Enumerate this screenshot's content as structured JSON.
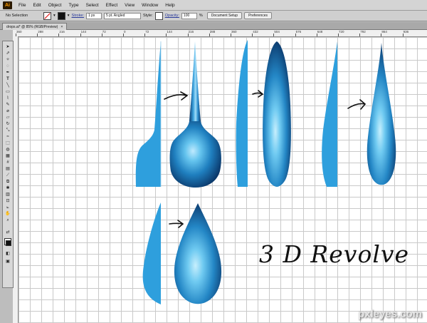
{
  "app": {
    "logo": "Ai"
  },
  "menu": {
    "items": [
      "File",
      "Edit",
      "Object",
      "Type",
      "Select",
      "Effect",
      "View",
      "Window",
      "Help"
    ]
  },
  "control_bar": {
    "selection": "No Selection",
    "stroke_label": "Stroke:",
    "stroke_weight": "1 px",
    "brush": "5 pt. Angled",
    "style_label": "Style:",
    "opacity_label": "Opacity:",
    "opacity_value": "100",
    "opacity_unit": "%",
    "document_setup": "Document Setup",
    "preferences": "Preferences"
  },
  "document": {
    "tab_label": "drops.ai* @ 85% (RGB/Preview)",
    "close_glyph": "×"
  },
  "ruler": {
    "labels": [
      "360",
      "288",
      "216",
      "144",
      "72",
      "0",
      "72",
      "144",
      "216",
      "288",
      "360",
      "432",
      "504",
      "576",
      "648",
      "720",
      "792",
      "864",
      "936"
    ]
  },
  "canvas": {
    "annotation": "3 D Revolve"
  },
  "watermark": "pxleyes.com",
  "colors": {
    "profile_blue": "#2e9fdd",
    "drop_dark": "#0c3d73",
    "drop_light": "#7fd3f5"
  }
}
